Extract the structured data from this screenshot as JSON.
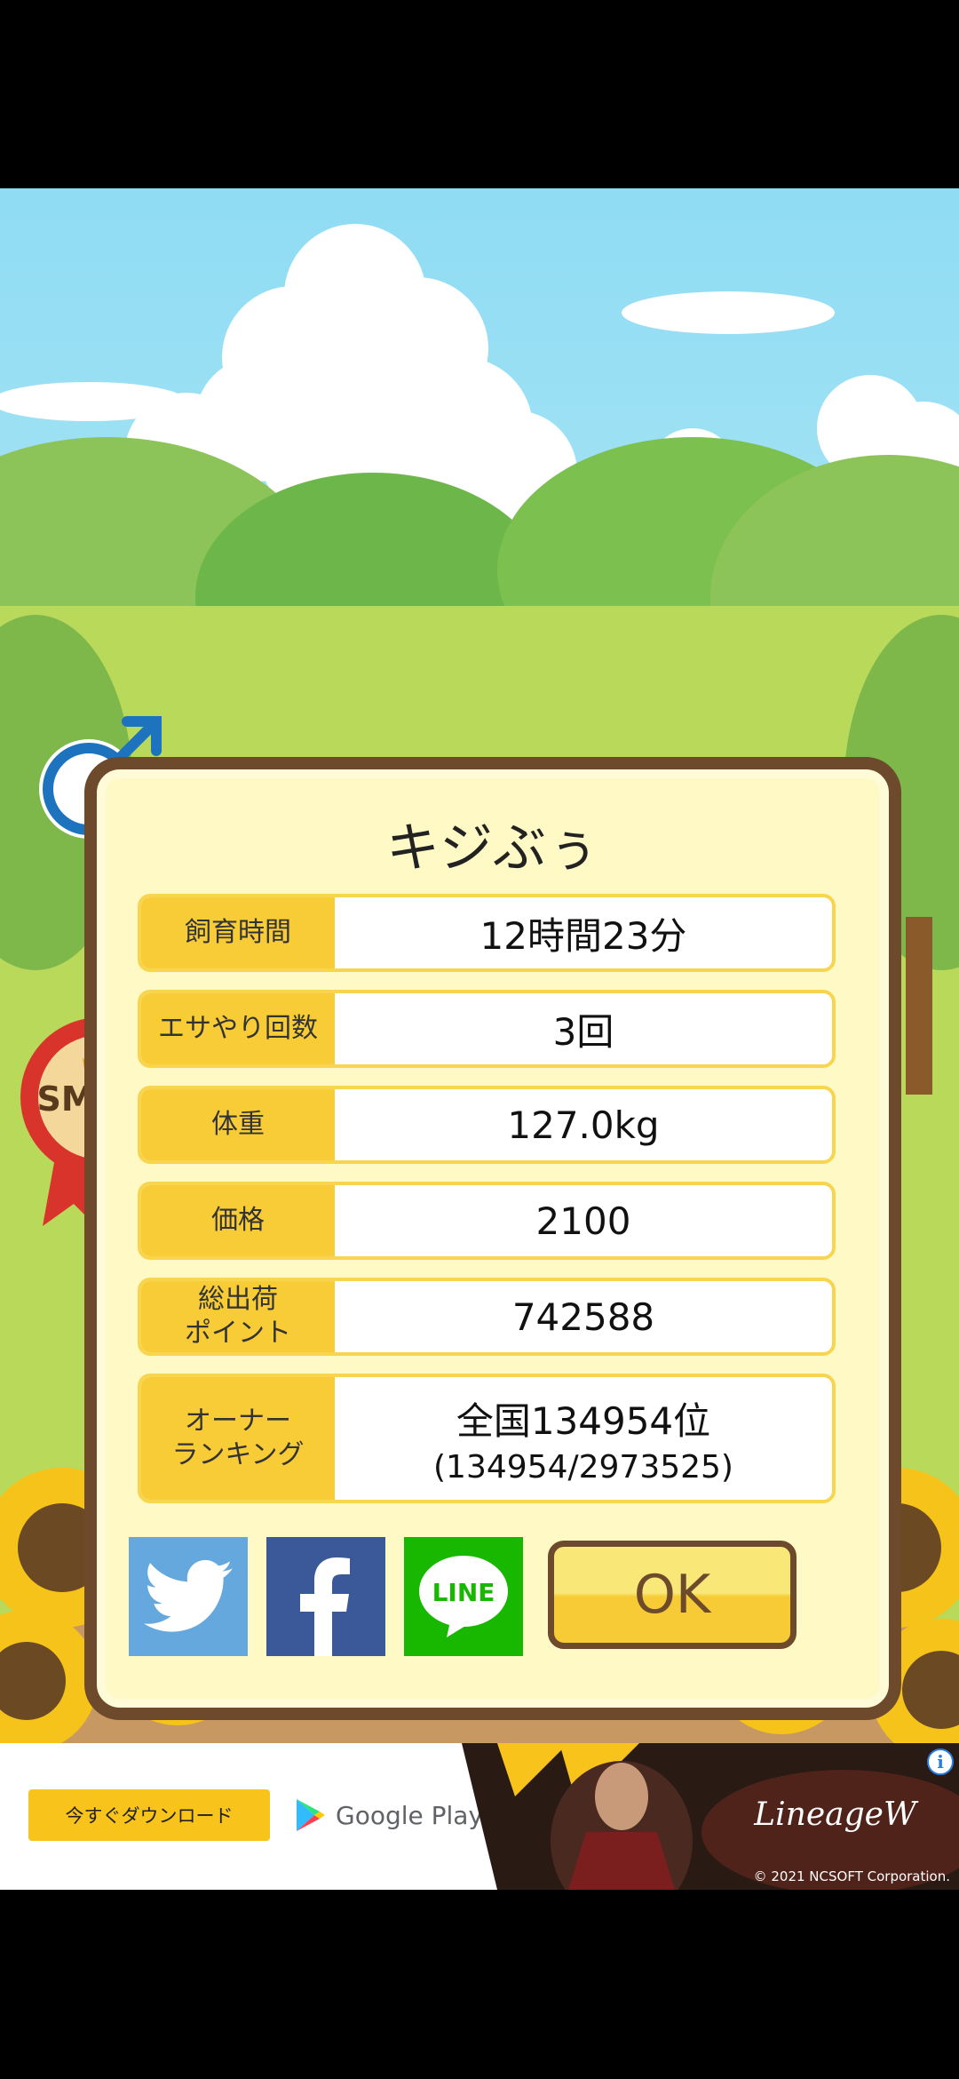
{
  "dialog": {
    "title": "キジぶぅ",
    "rows": [
      {
        "label": "飼育時間",
        "value": "12時間23分"
      },
      {
        "label": "エサやり回数",
        "value": "3回"
      },
      {
        "label": "体重",
        "value": "127.0kg"
      },
      {
        "label": "価格",
        "value": "2100"
      },
      {
        "label": "総出荷\nポイント",
        "value": "742588"
      },
      {
        "label": "オーナー\nランキング",
        "value": "全国134954位",
        "sub": "(134954/2973525)"
      }
    ],
    "ok_label": "OK",
    "share": {
      "line_label": "LINE"
    }
  },
  "badges": {
    "gender_label": "オス",
    "size_label": "SMALL"
  },
  "ad": {
    "download_label": "今すぐダウンロード",
    "store_label": "Google Play",
    "game_logo": "LineageW",
    "copyright": "© 2021 NCSOFT Corporation.",
    "info_icon": "i"
  },
  "colors": {
    "panel": "#fff9c6",
    "border": "#6c4a2b",
    "label_bg": "#f8cc36",
    "twitter": "#64a8de",
    "facebook": "#3b5998",
    "line": "#18b800"
  }
}
